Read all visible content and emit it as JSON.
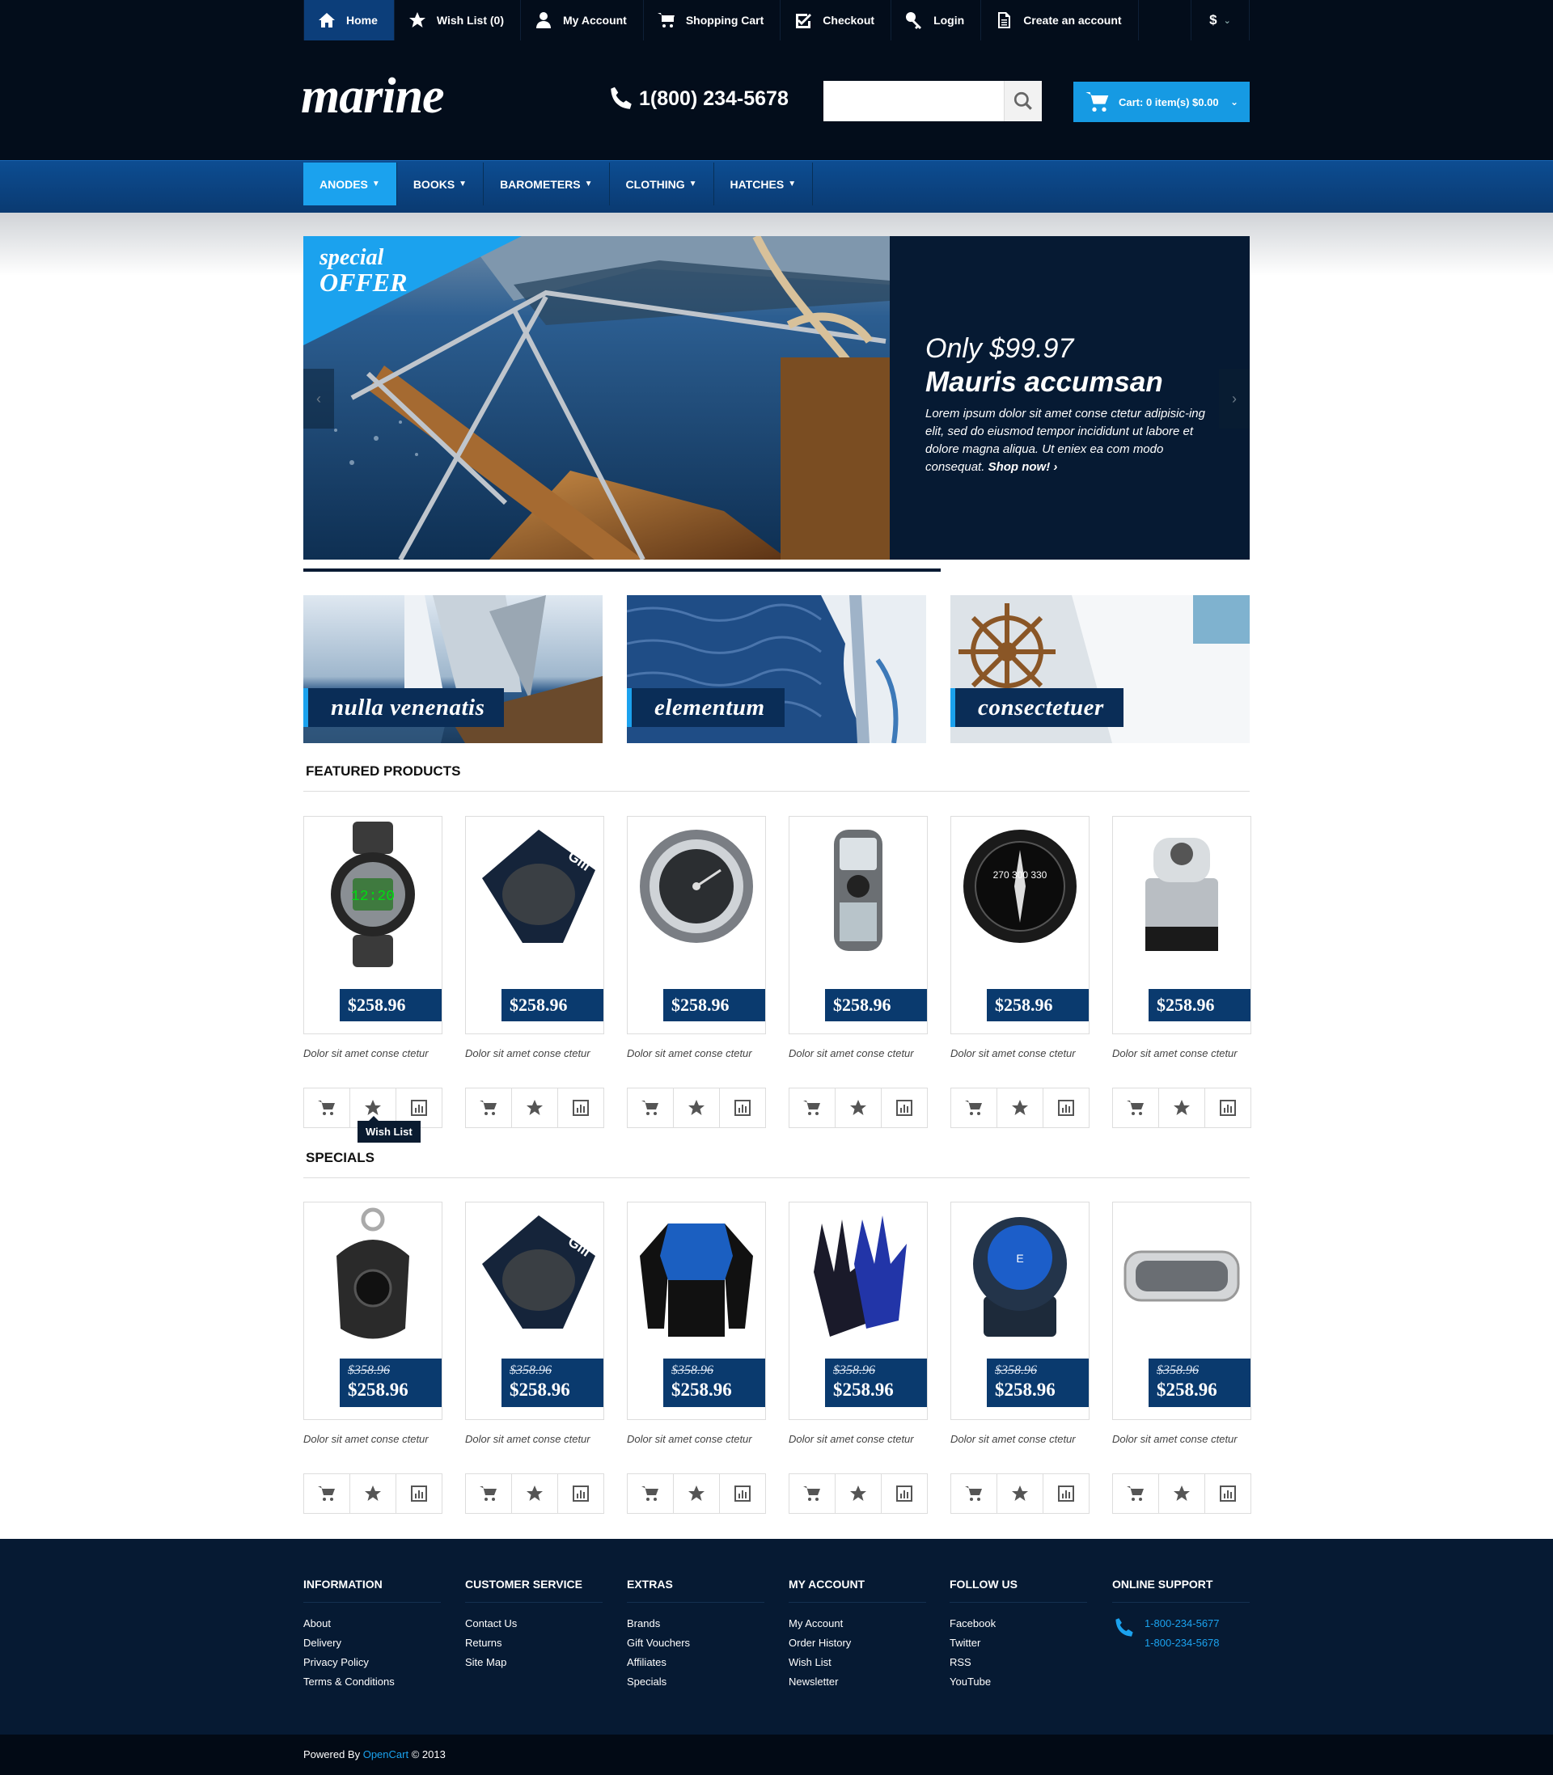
{
  "topnav": {
    "items": [
      {
        "label": "Home",
        "icon": "home-icon"
      },
      {
        "label": "Wish List (0)",
        "icon": "star-icon"
      },
      {
        "label": "My Account",
        "icon": "user-icon"
      },
      {
        "label": "Shopping Cart",
        "icon": "cart-icon"
      },
      {
        "label": "Checkout",
        "icon": "checkbox-icon"
      },
      {
        "label": "Login",
        "icon": "key-icon"
      },
      {
        "label": "Create an account",
        "icon": "document-icon"
      }
    ],
    "currency": "$"
  },
  "header": {
    "logo": "marine",
    "phone": "1(800) 234-5678",
    "search_placeholder": "",
    "cart_label": "Cart: 0 item(s) $0.00"
  },
  "mainnav": {
    "items": [
      "ANODES",
      "BOOKS",
      "BAROMETERS",
      "CLOTHING",
      "HATCHES"
    ]
  },
  "slider": {
    "badge_line1": "special",
    "badge_line2": "OFFER",
    "price_line": "Only $99.97",
    "title": "Mauris accumsan",
    "description": "Lorem ipsum dolor sit amet conse ctetur adipisic-ing elit, sed do eiusmod tempor incididunt ut labore et dolore magna aliqua. Ut eniex ea com modo consequat.",
    "shop_link": "Shop now!"
  },
  "banners": [
    {
      "label": "nulla venenatis"
    },
    {
      "label": "elementum"
    },
    {
      "label": "consectetuer"
    }
  ],
  "featured": {
    "title": "FEATURED PRODUCTS",
    "products": [
      {
        "name": "Dolor sit amet conse ctetur",
        "price": "$258.96",
        "image": "watch"
      },
      {
        "name": "Dolor sit amet conse ctetur",
        "price": "$258.96",
        "image": "knee-pad"
      },
      {
        "name": "Dolor sit amet conse ctetur",
        "price": "$258.96",
        "image": "barometer"
      },
      {
        "name": "Dolor sit amet conse ctetur",
        "price": "$258.96",
        "image": "gps"
      },
      {
        "name": "Dolor sit amet conse ctetur",
        "price": "$258.96",
        "image": "compass"
      },
      {
        "name": "Dolor sit amet conse ctetur",
        "price": "$258.96",
        "image": "winch"
      }
    ]
  },
  "specials": {
    "title": "SPECIALS",
    "products": [
      {
        "name": "Dolor sit amet conse ctetur",
        "old_price": "$358.96",
        "price": "$258.96",
        "image": "block"
      },
      {
        "name": "Dolor sit amet conse ctetur",
        "old_price": "$358.96",
        "price": "$258.96",
        "image": "knee-pad"
      },
      {
        "name": "Dolor sit amet conse ctetur",
        "old_price": "$358.96",
        "price": "$258.96",
        "image": "jacket"
      },
      {
        "name": "Dolor sit amet conse ctetur",
        "old_price": "$358.96",
        "price": "$258.96",
        "image": "gloves"
      },
      {
        "name": "Dolor sit amet conse ctetur",
        "old_price": "$358.96",
        "price": "$258.96",
        "image": "compass-blue"
      },
      {
        "name": "Dolor sit amet conse ctetur",
        "old_price": "$358.96",
        "price": "$258.96",
        "image": "hatch"
      }
    ]
  },
  "tooltip": "Wish List",
  "footer": {
    "columns": [
      {
        "title": "INFORMATION",
        "links": [
          "About",
          "Delivery",
          "Privacy Policy",
          "Terms & Conditions"
        ]
      },
      {
        "title": "CUSTOMER SERVICE",
        "links": [
          "Contact Us",
          "Returns",
          "Site Map"
        ]
      },
      {
        "title": "EXTRAS",
        "links": [
          "Brands",
          "Gift Vouchers",
          "Affiliates",
          "Specials"
        ]
      },
      {
        "title": "MY ACCOUNT",
        "links": [
          "My Account",
          "Order History",
          "Wish List",
          "Newsletter"
        ]
      },
      {
        "title": "FOLLOW US",
        "links": [
          "Facebook",
          "Twitter",
          "RSS",
          "YouTube"
        ]
      },
      {
        "title": "ONLINE SUPPORT",
        "links": [
          "1-800-234-5677",
          "1-800-234-5678"
        ]
      }
    ],
    "powered_prefix": "Powered By",
    "powered_link": "OpenCart",
    "powered_suffix": "© 2013"
  },
  "colors": {
    "accent": "#1ba2ee",
    "navy": "#061a33",
    "price_bg": "#0a3a6e"
  }
}
